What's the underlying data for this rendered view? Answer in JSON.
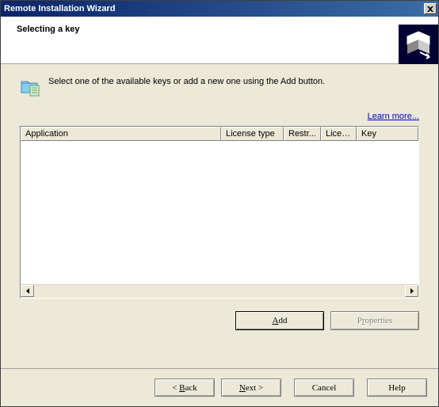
{
  "window": {
    "title": "Remote Installation Wizard"
  },
  "header": {
    "title": "Selecting a key"
  },
  "content": {
    "instruction": "Select one of the available keys or add a new one using the Add button.",
    "learn_more": "Learn more..."
  },
  "listview": {
    "cols": {
      "c0": "Application",
      "c1": "License type",
      "c2": "Restr...",
      "c3": "Licen...",
      "c4": "Key"
    }
  },
  "mid_buttons": {
    "add_pre": "",
    "add_u": "A",
    "add_post": "dd",
    "properties_pre": "P",
    "properties_u": "r",
    "properties_post": "operties"
  },
  "footer": {
    "back_pre": "< ",
    "back_u": "B",
    "back_post": "ack",
    "next_pre": "",
    "next_u": "N",
    "next_post": "ext >",
    "cancel": "Cancel",
    "help": "Help"
  }
}
